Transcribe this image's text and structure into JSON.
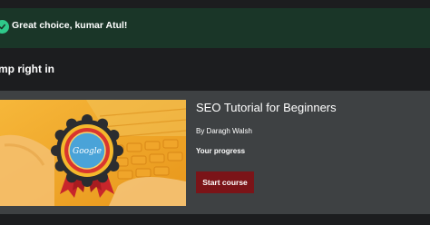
{
  "alert": {
    "icon": "check-circle-icon",
    "message": "Great choice, kumar Atul!",
    "accent_color": "#2fc98a",
    "background_color": "#1a3628"
  },
  "section": {
    "title": "mp right in"
  },
  "course": {
    "title": "SEO Tutorial for Beginners",
    "instructor": "By Daragh Walsh",
    "progress_label": "Your progress",
    "start_button_label": "Start course",
    "button_color": "#7b1418",
    "thumbnail": {
      "badge_text": "Google",
      "description": "google-badge-over-laptop-keyboard",
      "tint_color": "#f2a81d"
    }
  }
}
